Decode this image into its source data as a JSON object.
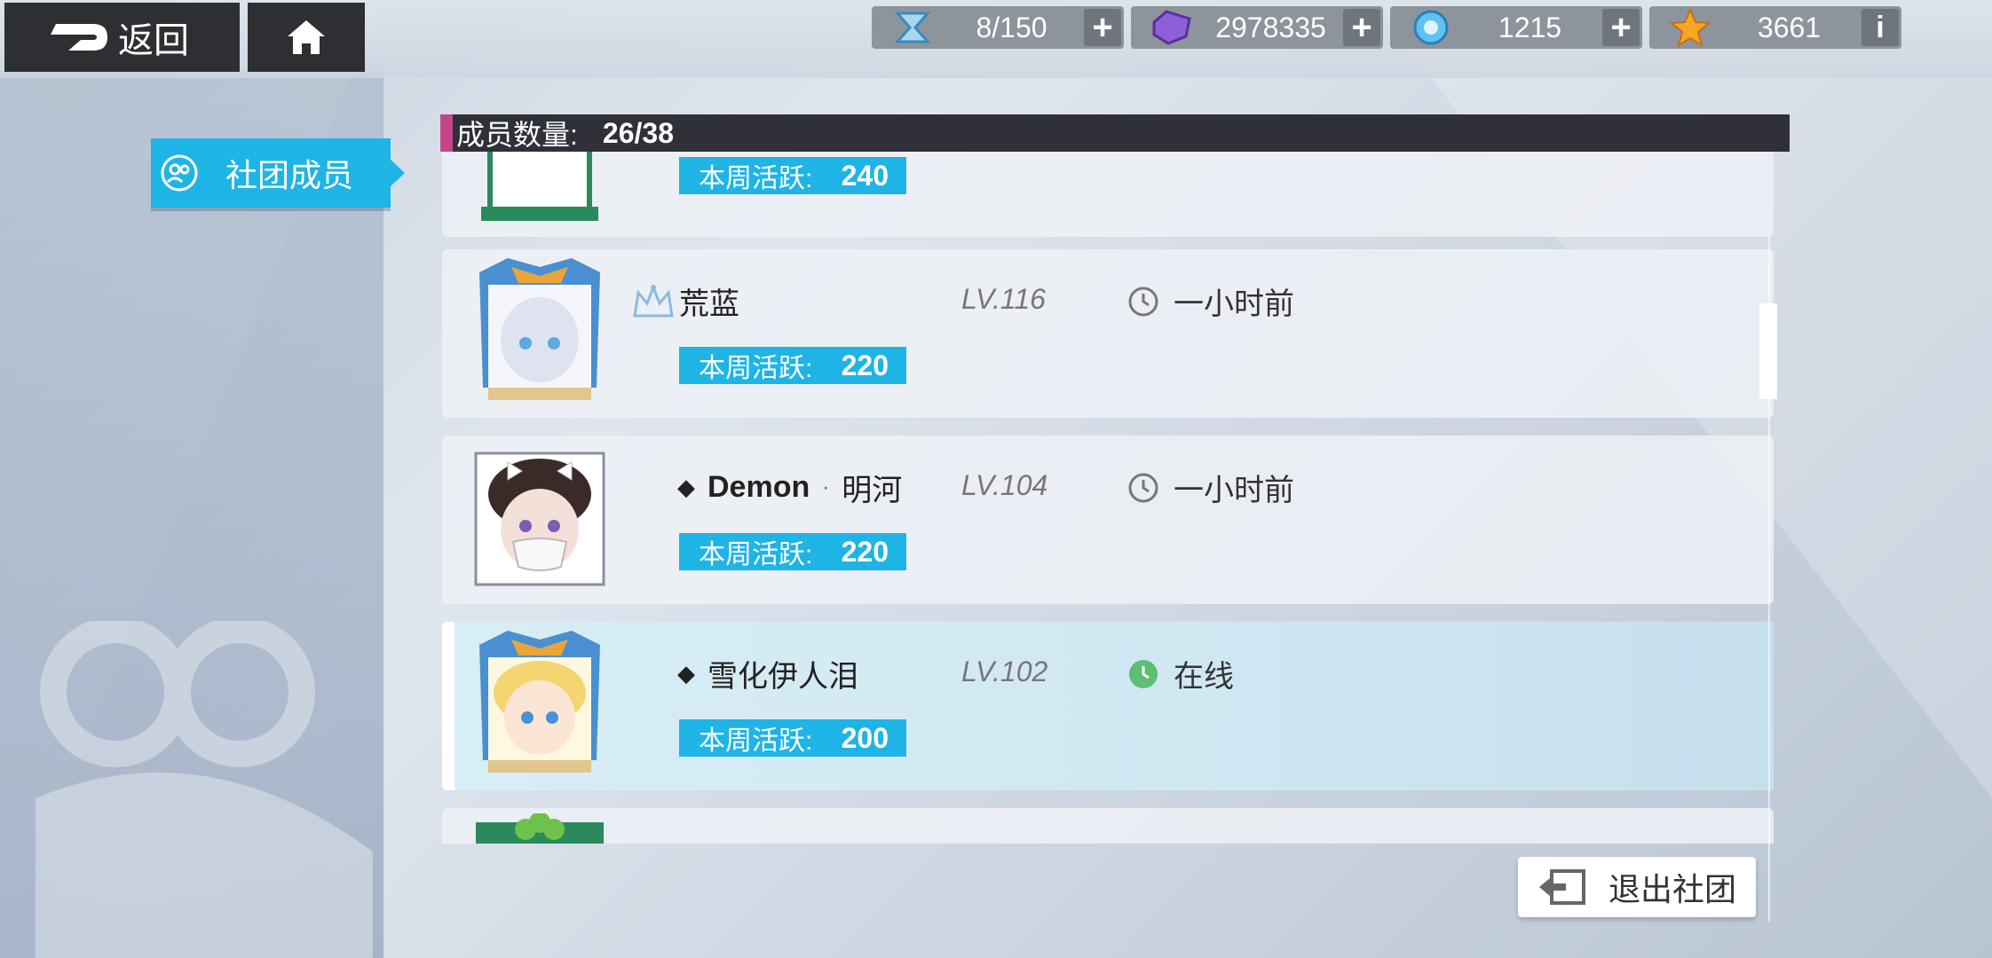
{
  "topbar": {
    "back_label": "返回",
    "resources": [
      {
        "name": "stamina",
        "icon": "hourglass-icon",
        "value": "8/150",
        "has_plus": true
      },
      {
        "name": "gems",
        "icon": "purple-crystal-icon",
        "value": "2978335",
        "has_plus": true
      },
      {
        "name": "orbs",
        "icon": "blue-orb-icon",
        "value": "1215",
        "has_plus": true
      },
      {
        "name": "stars",
        "icon": "star-icon",
        "value": "3661",
        "has_info": true
      }
    ],
    "plus_label": "+",
    "info_label": "i"
  },
  "sidebar": {
    "tab_label": "社团成员"
  },
  "header": {
    "count_label": "成员数量:",
    "count_value": "26/38"
  },
  "members": [
    {
      "name": "",
      "level": "",
      "activity_label": "本周活跃:",
      "activity_value": "240",
      "status": "",
      "partial": true
    },
    {
      "name": "荒蓝",
      "leader": true,
      "level": "LV.116",
      "activity_label": "本周活跃:",
      "activity_value": "220",
      "status": "一小时前",
      "online": false
    },
    {
      "name": "Demon",
      "name_suffix": "明河",
      "level": "LV.104",
      "activity_label": "本周活跃:",
      "activity_value": "220",
      "status": "一小时前",
      "online": false
    },
    {
      "name": "雪化伊人泪",
      "level": "LV.102",
      "activity_label": "本周活跃:",
      "activity_value": "200",
      "status": "在线",
      "online": true,
      "highlight": true
    }
  ],
  "footer": {
    "exit_label": "退出社团"
  },
  "colors": {
    "accent": "#1fb4e6",
    "dark_bar": "#2f3038",
    "pink_marker": "#c5458b",
    "online_green": "#5cbf72"
  }
}
